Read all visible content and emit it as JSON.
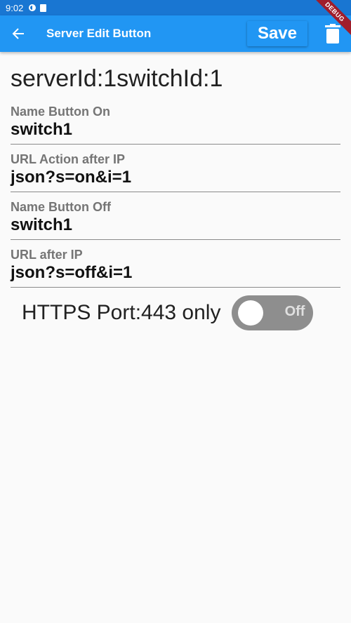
{
  "status_bar": {
    "time": "9:02"
  },
  "debug_banner": "DEBUG",
  "app_bar": {
    "title": "Server Edit Button",
    "save_label": "Save"
  },
  "heading": "serverId:1switchId:1",
  "fields": [
    {
      "label": "Name Button On",
      "value": "switch1"
    },
    {
      "label": "URL Action after IP",
      "value": "json?s=on&i=1"
    },
    {
      "label": "Name Button Off",
      "value": "switch1"
    },
    {
      "label": "URL after IP",
      "value": "json?s=off&i=1"
    }
  ],
  "https": {
    "label": "HTTPS Port:443 only",
    "toggle_text": "Off",
    "enabled": false
  },
  "colors": {
    "app_bar": "#2196f3",
    "status_bar": "#1976d2",
    "toggle_off": "#8e8e8e"
  }
}
